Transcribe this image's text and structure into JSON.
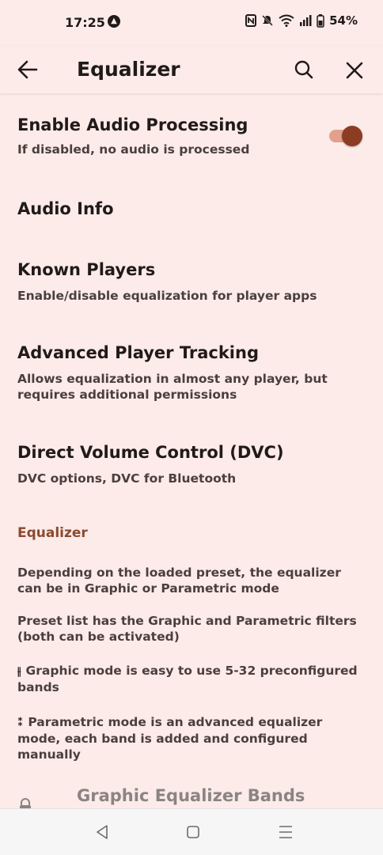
{
  "status_bar": {
    "time": "17:25",
    "battery": "54%",
    "icons": [
      "nfc-icon",
      "mute-icon",
      "wifi-icon",
      "signal-icon",
      "battery-icon"
    ]
  },
  "app_bar": {
    "title": "Equalizer",
    "back_icon": "arrow-left-icon",
    "search_icon": "search-icon",
    "close_icon": "close-icon"
  },
  "settings": [
    {
      "title": "Enable Audio Processing",
      "subtitle": "If disabled, no audio is processed",
      "toggle": true
    },
    {
      "title": "Audio Info",
      "subtitle": ""
    },
    {
      "title": "Known Players",
      "subtitle": "Enable/disable equalization for player apps"
    },
    {
      "title": "Advanced Player Tracking",
      "subtitle": "Allows equalization in almost any player, but requires additional permissions"
    },
    {
      "title": "Direct Volume Control (DVC)",
      "subtitle": "DVC options, DVC for Bluetooth"
    }
  ],
  "equalizer_section": {
    "header": "Equalizer",
    "info": [
      "Depending on the loaded preset, the equalizer can be in Graphic or Parametric mode",
      "Preset list has the Graphic and Parametric filters (both can be activated)",
      "Graphic mode is easy to use 5-32 preconfigured bands",
      "Parametric mode is an advanced equalizer mode, each band is added and configured manually"
    ],
    "graphic_icon": "sliders-icon",
    "parametric_icon": "knob-icon"
  },
  "partial_row": {
    "title": "Graphic Equalizer Bands",
    "icon": "lock-icon"
  },
  "colors": {
    "accent": "#8b3c22",
    "background": "#fcebe8",
    "section_header": "#8b4a2f"
  }
}
